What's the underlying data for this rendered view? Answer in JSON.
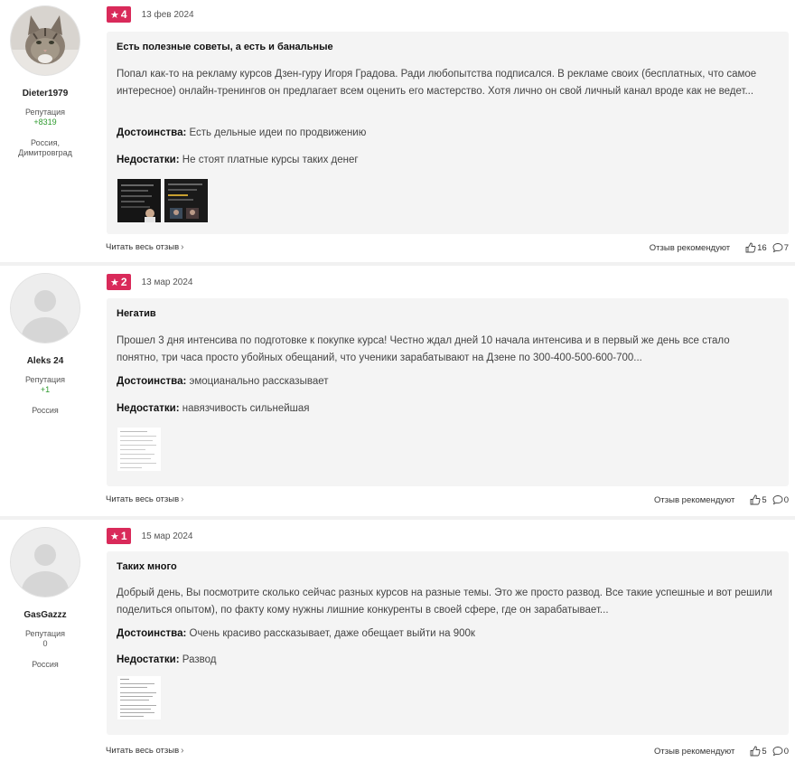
{
  "reviews": [
    {
      "author": "Dieter1979",
      "reputation_label": "Репутация",
      "reputation": "+8319",
      "location": "Россия, Димитровград",
      "rating": "4",
      "date": "13 фев 2024",
      "title": "Есть полезные советы, а есть и банальные",
      "text": "Попал как-то на рекламу курсов Дзен-гуру Игоря Градова. Ради любопытства подписался. В рекламе своих (бесплатных, что самое интересное) онлайн-тренингов он предлагает всем оценить его мастерство. Хотя лично он свой личный канал вроде как не ведет...",
      "pros_label": "Достоинства:",
      "pros": "Есть дельные идеи по продвижению",
      "cons_label": "Недостатки:",
      "cons": "Не стоят платные курсы таких денег",
      "read_more": "Читать весь отзыв",
      "recommend_label": "Отзыв рекомендуют",
      "likes": "16",
      "comments": "7"
    },
    {
      "author": "Aleks 24",
      "reputation_label": "Репутация",
      "reputation": "+1",
      "location": "Россия",
      "rating": "2",
      "date": "13 мар 2024",
      "title": "Негатив",
      "text": "Прошел 3 дня интенсива по подготовке к покупке курса! Честно ждал дней 10 начала интенсива и в первый же день все стало понятно, три часа просто убойных обещаний, что ученики зарабатывают на Дзене по 300-400-500-600-700...",
      "pros_label": "Достоинства:",
      "pros": "эмоцианально рассказывает",
      "cons_label": "Недостатки:",
      "cons": "навязчивость сильнейшая",
      "read_more": "Читать весь отзыв",
      "recommend_label": "Отзыв рекомендуют",
      "likes": "5",
      "comments": "0"
    },
    {
      "author": "GasGazzz",
      "reputation_label": "Репутация",
      "reputation": "0",
      "location": "Россия",
      "rating": "1",
      "date": "15 мар 2024",
      "title": "Таких много",
      "text": "Добрый день, Вы посмотрите сколько сейчас разных курсов на разные темы. Это же просто развод. Все такие успешные и вот решили поделиться опытом), по факту кому нужны лишние конкуренты в своей сфере, где он зарабатывает...",
      "pros_label": "Достоинства:",
      "pros": "Очень красиво рассказывает, даже обещает выйти на 900к",
      "cons_label": "Недостатки:",
      "cons": "Развод",
      "read_more": "Читать весь отзыв",
      "recommend_label": "Отзыв рекомендуют",
      "likes": "5",
      "comments": "0"
    }
  ],
  "icons": {
    "star": "star-icon",
    "chevron": "chevron-right-icon",
    "like": "thumbs-up-icon",
    "comment": "comment-icon"
  },
  "colors": {
    "rating_badge": "#d92a5a",
    "card_bg": "#f4f4f4",
    "reputation_positive": "#2e9a2e"
  }
}
